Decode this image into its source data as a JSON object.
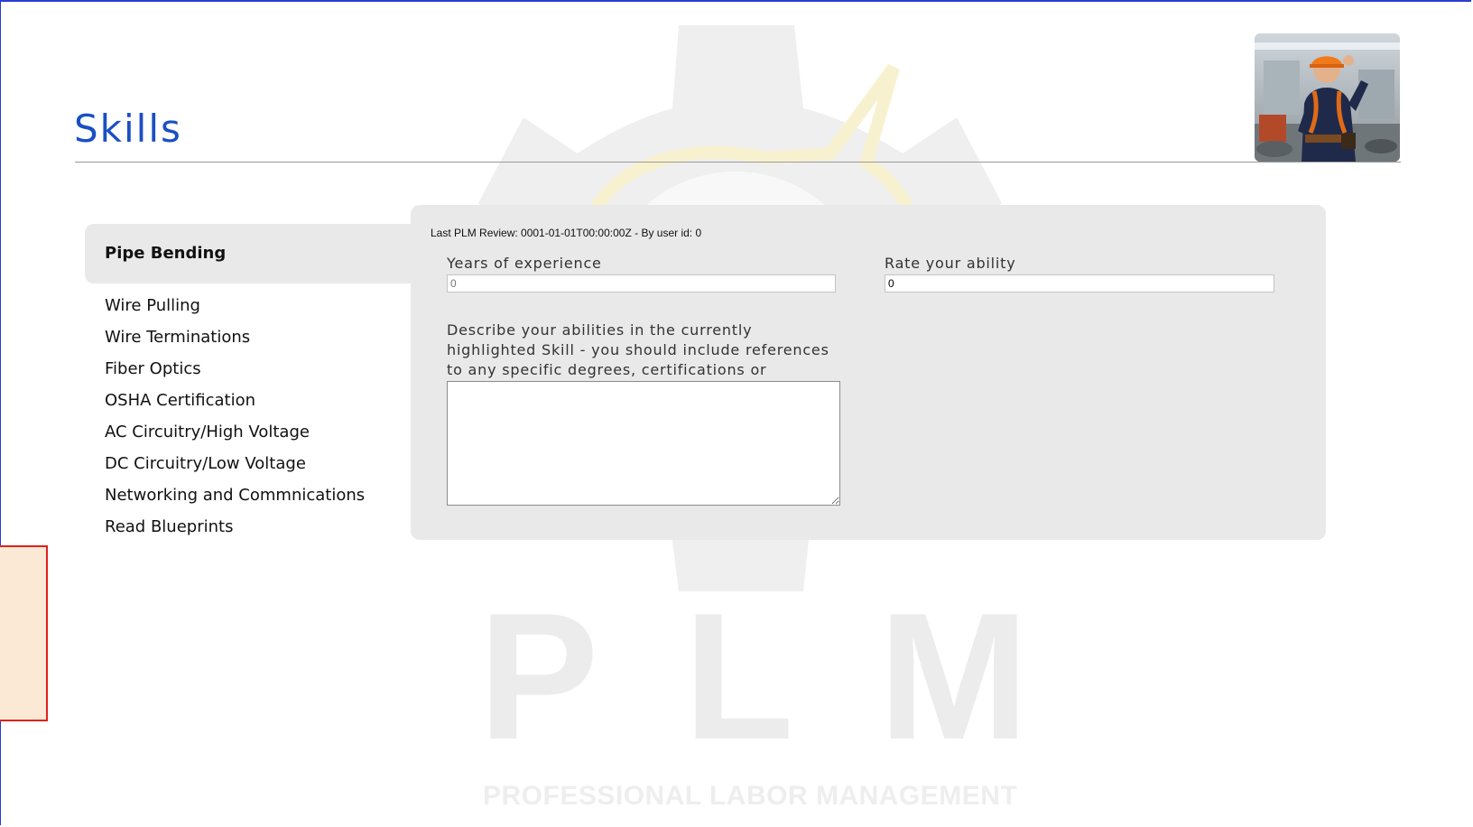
{
  "header": {
    "title": "Skills",
    "photo_alt": "worker-photo"
  },
  "watermark": {
    "letters": [
      "P",
      "L",
      "M"
    ],
    "tagline": "PROFESSIONAL LABOR MANAGEMENT"
  },
  "skills": {
    "items": [
      {
        "label": "Pipe Bending",
        "active": true
      },
      {
        "label": "Wire Pulling",
        "active": false
      },
      {
        "label": "Wire Terminations",
        "active": false
      },
      {
        "label": "Fiber Optics",
        "active": false
      },
      {
        "label": "OSHA Certification",
        "active": false
      },
      {
        "label": "AC Circuitry/High Voltage",
        "active": false
      },
      {
        "label": "DC Circuitry/Low Voltage",
        "active": false
      },
      {
        "label": "Networking and Commnications",
        "active": false
      },
      {
        "label": "Read Blueprints",
        "active": false
      }
    ]
  },
  "form": {
    "review_info": "Last PLM Review: 0001-01-01T00:00:00Z - By user id: 0",
    "years_label": "Years of experience",
    "years_value": "0",
    "ability_label": "Rate your ability",
    "ability_value": "0",
    "description_label": "Describe your abilities in the currently highlighted Skill - you should include references to any specific degrees, certifications or experience",
    "description_value": ""
  },
  "colors": {
    "title": "#1a4fc4",
    "panel_bg": "#e9e9e9",
    "side_box_fill": "#fbe8d5",
    "side_box_border": "#e0221c",
    "frame_border": "#2a3bd6"
  }
}
